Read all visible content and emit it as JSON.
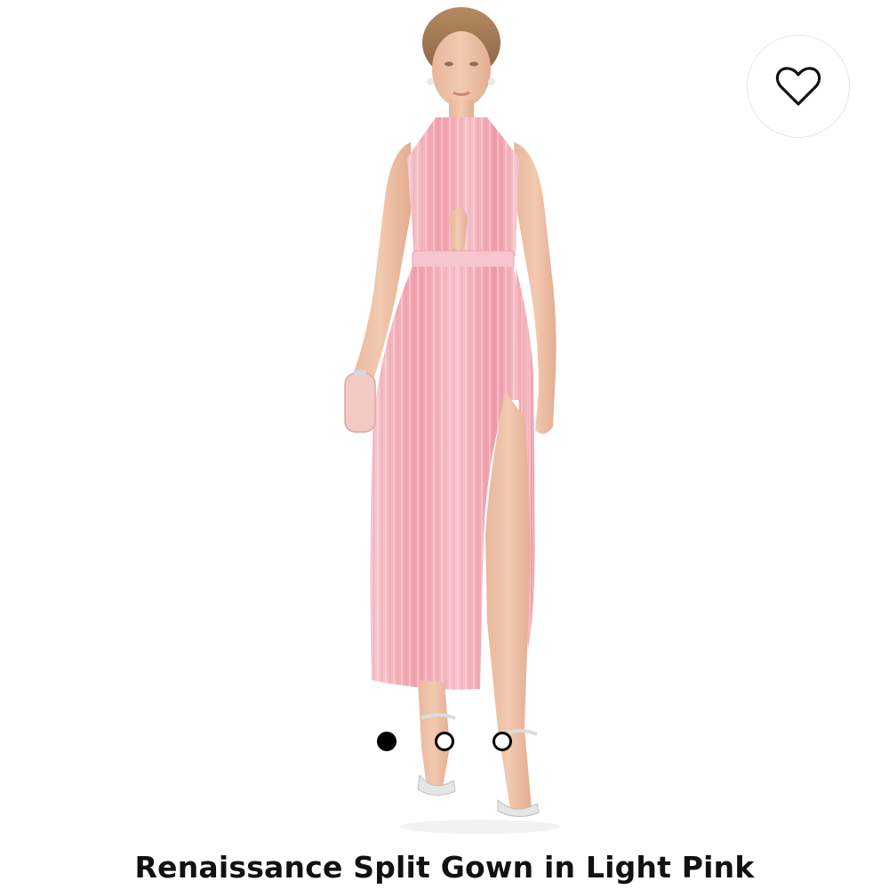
{
  "product": {
    "title": "Renaissance Split Gown in Light Pink"
  },
  "wishlist": {
    "icon": "heart-outline-icon"
  },
  "carousel": {
    "total_images": 3,
    "active_index": 0
  },
  "colors": {
    "background": "#ffffff",
    "dress_pink": "#f2b3bd",
    "dot_active": "#000000",
    "title_text": "#111111"
  }
}
